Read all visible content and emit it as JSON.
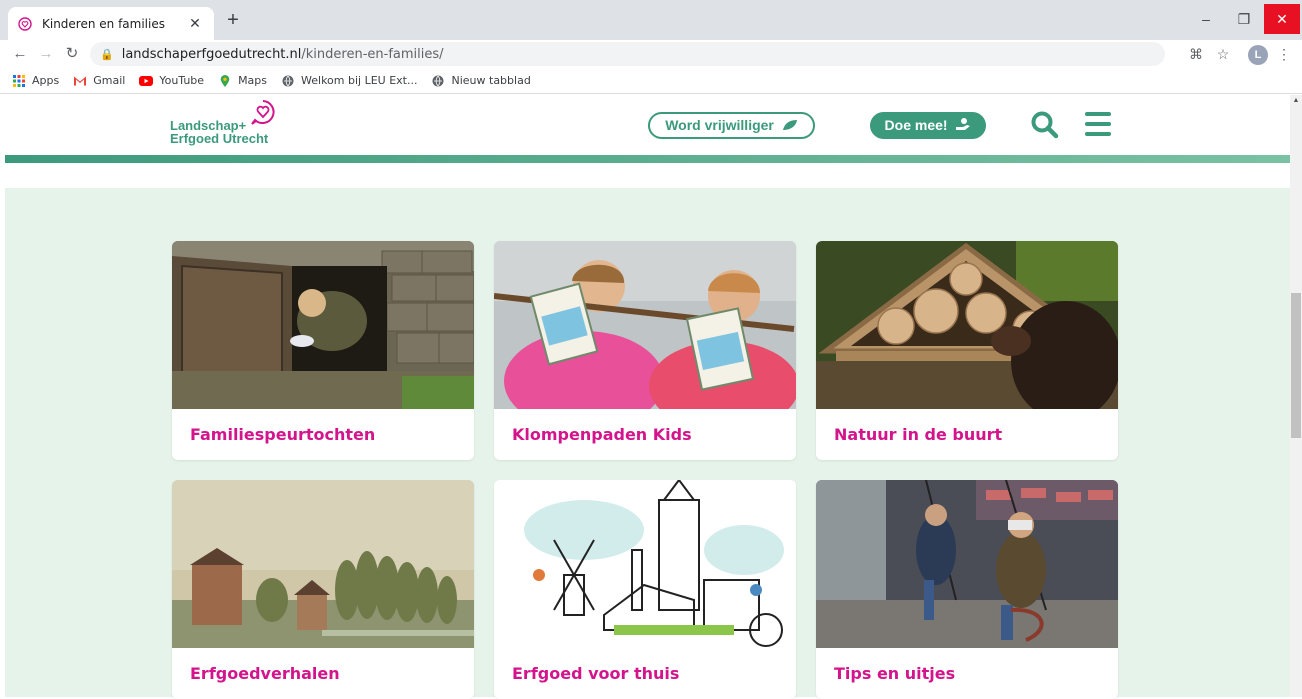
{
  "browser": {
    "tab_title": "Kinderen en families",
    "url_host": "landschaperfgoedutrecht.nl",
    "url_path": "/kinderen-en-families/",
    "profile_initial": "L"
  },
  "bookmarks": [
    {
      "label": "Apps",
      "icon": "apps-grid-icon"
    },
    {
      "label": "Gmail",
      "icon": "gmail-icon"
    },
    {
      "label": "YouTube",
      "icon": "youtube-icon"
    },
    {
      "label": "Maps",
      "icon": "maps-pin-icon"
    },
    {
      "label": "Welkom bij LEU Ext...",
      "icon": "globe-icon"
    },
    {
      "label": "Nieuw tabblad",
      "icon": "globe-icon"
    }
  ],
  "header": {
    "logo_line1": "Landschap+",
    "logo_line2": "Erfgoed Utrecht",
    "volunteer_label": "Word vrijwilliger",
    "join_label": "Doe mee!"
  },
  "colors": {
    "brand_green": "#3c9a7c",
    "card_title_pink": "#d4148c",
    "content_background": "#e5f3ea"
  },
  "cards": [
    {
      "title": "Familiespeurtochten",
      "image": "girl-crawling-through-bunker-door"
    },
    {
      "title": "Klompenpaden Kids",
      "image": "girls-reading-kids-booklets"
    },
    {
      "title": "Natuur in de buurt",
      "image": "insect-hotel"
    },
    {
      "title": "Erfgoedverhalen",
      "image": "historic-painting-manor-and-trees"
    },
    {
      "title": "Erfgoed voor thuis",
      "image": "illustration-windmill-and-dom-tower"
    },
    {
      "title": "Tips en uitjes",
      "image": "children-on-swings-with-vr-headsets"
    }
  ]
}
